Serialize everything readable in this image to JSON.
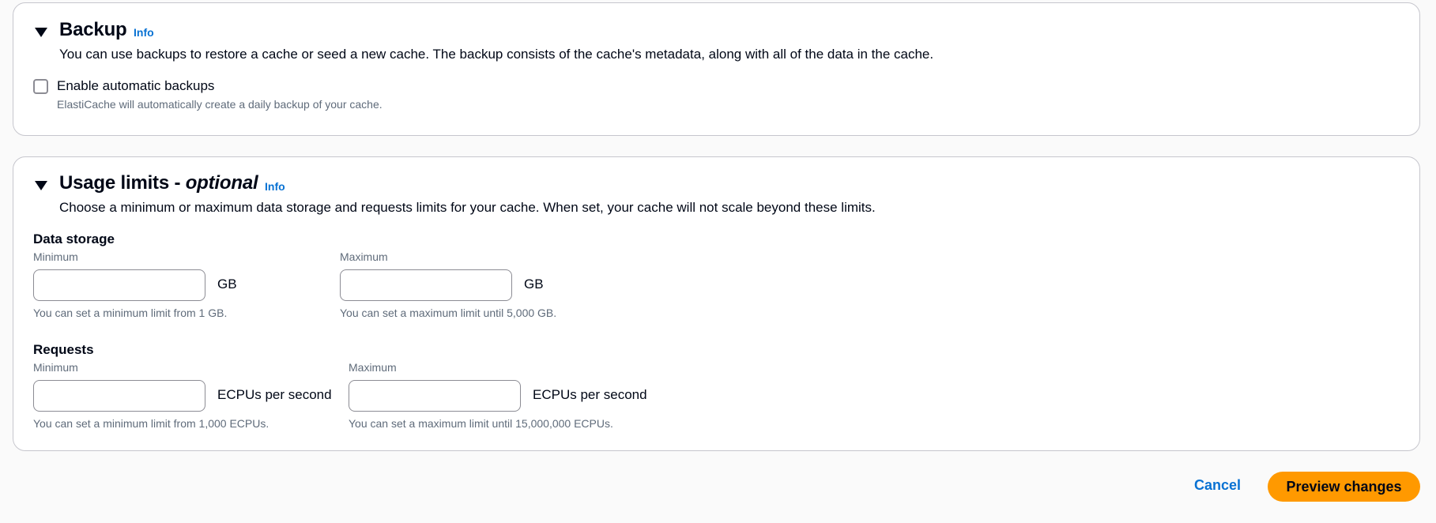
{
  "backup": {
    "title": "Backup",
    "info_label": "Info",
    "description": "You can use backups to restore a cache or seed a new cache. The backup consists of the cache's metadata, along with all of the data in the cache.",
    "checkbox_label": "Enable automatic backups",
    "checkbox_checked": false,
    "checkbox_hint": "ElastiCache will automatically create a daily backup of your cache."
  },
  "usage": {
    "title": "Usage limits - ",
    "title_optional": "optional",
    "info_label": "Info",
    "description": "Choose a minimum or maximum data storage and requests limits for your cache. When set, your cache will not scale beyond these limits.",
    "data_storage": {
      "label": "Data storage",
      "min": {
        "label": "Minimum",
        "value": "",
        "unit": "GB",
        "hint": "You can set a minimum limit from 1 GB."
      },
      "max": {
        "label": "Maximum",
        "value": "",
        "unit": "GB",
        "hint": "You can set a maximum limit until 5,000 GB."
      }
    },
    "requests": {
      "label": "Requests",
      "min": {
        "label": "Minimum",
        "value": "",
        "unit": "ECPUs per second",
        "hint": "You can set a minimum limit from 1,000 ECPUs."
      },
      "max": {
        "label": "Maximum",
        "value": "",
        "unit": "ECPUs per second",
        "hint": "You can set a maximum limit until 15,000,000 ECPUs."
      }
    }
  },
  "actions": {
    "cancel_label": "Cancel",
    "preview_label": "Preview changes"
  },
  "colors": {
    "link": "#0972d3",
    "primary_button": "#ff9900",
    "border": "#c6c6cd",
    "text": "#000716",
    "secondary_text": "#5f6b7a"
  }
}
